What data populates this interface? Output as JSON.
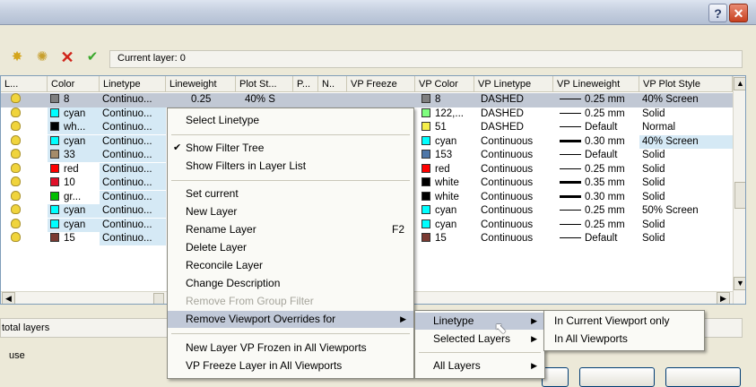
{
  "window": {
    "help_glyph": "?",
    "close_glyph": "✕"
  },
  "toolbar": {
    "icons": [
      "new-layer-icon",
      "new-layer-vp-frozen-icon",
      "delete-layer-icon",
      "set-current-icon"
    ],
    "current_layer_label": "Current layer: 0"
  },
  "table": {
    "headers": [
      "L...",
      "Color",
      "Linetype",
      "Lineweight",
      "Plot St...",
      "P...",
      "N..",
      "VP Freeze",
      "VP Color",
      "VP Linetype",
      "VP Lineweight",
      "VP Plot Style"
    ],
    "rows": [
      {
        "color_name": "8",
        "color": "#7f7f7f",
        "linetype": "Continuo...",
        "lineweight": "0.25",
        "plot_style": "40% S",
        "vp_color_name": "8",
        "vp_color": "#7f7f7f",
        "vp_linetype": "DASHED",
        "vp_lineweight": "0.25 mm",
        "vp_plot_style": "40% Screen",
        "weight": "thin"
      },
      {
        "color_name": "cyan",
        "color": "#00ffff",
        "linetype": "Continuo...",
        "vp_color_name": "122,...",
        "vp_color": "#7fff7f",
        "vp_linetype": "DASHED",
        "vp_lineweight": "0.25 mm",
        "vp_plot_style": "Solid",
        "weight": "thin"
      },
      {
        "color_name": "wh...",
        "color": "#000000",
        "linetype": "Continuo...",
        "vp_color_name": "51",
        "vp_color": "#f5ef4a",
        "vp_linetype": "DASHED",
        "vp_lineweight": "Default",
        "vp_plot_style": "Normal",
        "weight": "thin"
      },
      {
        "color_name": "cyan",
        "color": "#00ffff",
        "linetype": "Continuo...",
        "vp_color_name": "cyan",
        "vp_color": "#00ffff",
        "vp_linetype": "Continuous",
        "vp_lineweight": "0.30 mm",
        "vp_plot_style": "40% Screen",
        "weight": "thick"
      },
      {
        "color_name": "33",
        "color": "#a58c6a",
        "linetype": "Continuo...",
        "vp_color_name": "153",
        "vp_color": "#4f77a8",
        "vp_linetype": "Continuous",
        "vp_lineweight": "Default",
        "vp_plot_style": "Solid",
        "weight": "thin"
      },
      {
        "color_name": "red",
        "color": "#ff0000",
        "linetype": "Continuo...",
        "vp_color_name": "red",
        "vp_color": "#ff0000",
        "vp_linetype": "Continuous",
        "vp_lineweight": "0.25 mm",
        "vp_plot_style": "Solid",
        "weight": "thin"
      },
      {
        "color_name": "10",
        "color": "#e0102a",
        "linetype": "Continuo...",
        "vp_color_name": "white",
        "vp_color": "#000000",
        "vp_linetype": "Continuous",
        "vp_lineweight": "0.35 mm",
        "vp_plot_style": "Solid",
        "weight": "thick"
      },
      {
        "color_name": "gr...",
        "color": "#00c000",
        "linetype": "Continuo...",
        "vp_color_name": "white",
        "vp_color": "#000000",
        "vp_linetype": "Continuous",
        "vp_lineweight": "0.30 mm",
        "vp_plot_style": "Solid",
        "weight": "thick"
      },
      {
        "color_name": "cyan",
        "color": "#00ffff",
        "linetype": "Continuo...",
        "vp_color_name": "cyan",
        "vp_color": "#00ffff",
        "vp_linetype": "Continuous",
        "vp_lineweight": "0.25 mm",
        "vp_plot_style": "50% Screen",
        "weight": "thin"
      },
      {
        "color_name": "cyan",
        "color": "#00ffff",
        "linetype": "Continuo...",
        "vp_color_name": "cyan",
        "vp_color": "#00ffff",
        "vp_linetype": "Continuous",
        "vp_lineweight": "0.25 mm",
        "vp_plot_style": "Solid",
        "weight": "thin"
      },
      {
        "color_name": "15",
        "color": "#7a3a32",
        "linetype": "Continuo...",
        "vp_color_name": "15",
        "vp_color": "#7a3a32",
        "vp_linetype": "Continuous",
        "vp_lineweight": "Default",
        "vp_plot_style": "Solid",
        "weight": "thin"
      }
    ]
  },
  "status": {
    "total_layers": "total layers",
    "use": "use"
  },
  "context_menu": {
    "select_linetype": "Select Linetype",
    "show_filter_tree": "Show Filter Tree",
    "show_filters_in_list": "Show Filters in Layer List",
    "set_current": "Set current",
    "new_layer": "New Layer",
    "rename_layer": "Rename Layer",
    "rename_shortcut": "F2",
    "delete_layer": "Delete Layer",
    "reconcile_layer": "Reconcile Layer",
    "change_description": "Change Description",
    "remove_from_group_filter": "Remove From Group Filter",
    "remove_vp_overrides": "Remove Viewport Overrides for",
    "new_layer_vp_frozen": "New Layer VP Frozen in All Viewports",
    "vp_freeze_layer": "VP Freeze Layer in All Viewports"
  },
  "submenu": {
    "linetype": "Linetype",
    "selected_layers": "Selected Layers",
    "all_layers": "All Layers"
  },
  "submenu2": {
    "current_viewport_only": "In Current Viewport only",
    "all_viewports": "In All Viewports"
  },
  "glyphs": {
    "check": "✔",
    "arrow_right": "▶",
    "arrow_left": "◀",
    "arrow_up": "▲",
    "arrow_down": "▼",
    "menu_arrow": "▶"
  }
}
